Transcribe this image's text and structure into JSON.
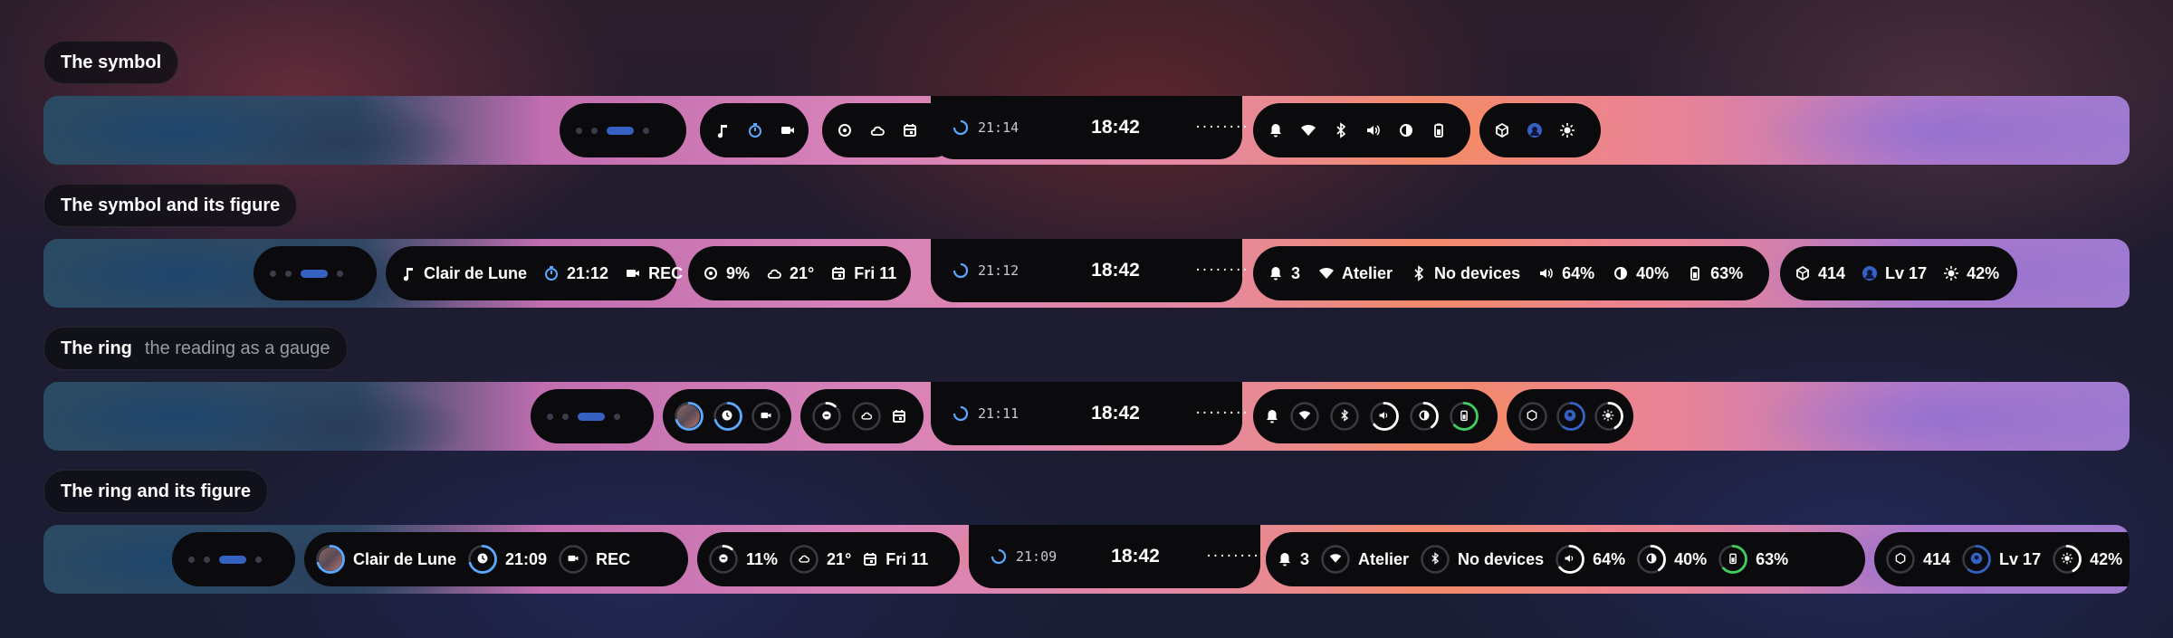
{
  "sections": [
    {
      "label": "The symbol",
      "sub": ""
    },
    {
      "label": "The symbol and its figure",
      "sub": ""
    },
    {
      "label": "The ring",
      "sub": "the reading as a gauge"
    },
    {
      "label": "The ring and its figure",
      "sub": ""
    }
  ],
  "clock": "18:42",
  "timers": [
    "21:14",
    "21:12",
    "21:11",
    "21:09"
  ],
  "media": {
    "track": "Clair de Lune",
    "timer": [
      "21:12",
      "21:09"
    ],
    "rec": "REC",
    "progress": 0.7
  },
  "system": {
    "cpu": "9%",
    "cpu_ring": "11%",
    "cpu_level": 0.11,
    "weather": "21°",
    "date": "Fri 11"
  },
  "status": {
    "notifications": "3",
    "wifi": "Atelier",
    "bluetooth": "No devices",
    "volume": "64%",
    "volume_level": 0.64,
    "brightness": "40%",
    "brightness_level": 0.4,
    "battery": "63%",
    "battery_level": 0.63
  },
  "extras": {
    "packages": "414",
    "packages_level": 0.3,
    "level": "Lv 17",
    "level_progress": 0.6,
    "sun": "42%",
    "sun_level": 0.42
  },
  "visualizer": "········",
  "colors": {
    "accent": "#3561c2",
    "ring_blue": "#5aa9ff",
    "battery_green": "#3fcf5f",
    "ring_track": "#3a3a42"
  },
  "icons": [
    "workspace-dots",
    "music-note-icon",
    "timer-icon",
    "camera-icon",
    "cpu-icon",
    "cloud-icon",
    "calendar-icon",
    "spinner-icon",
    "album-art",
    "bell-icon",
    "wifi-icon",
    "bluetooth-icon",
    "volume-icon",
    "brightness-icon",
    "battery-icon",
    "package-icon",
    "avatar-badge-icon",
    "sun-icon"
  ]
}
